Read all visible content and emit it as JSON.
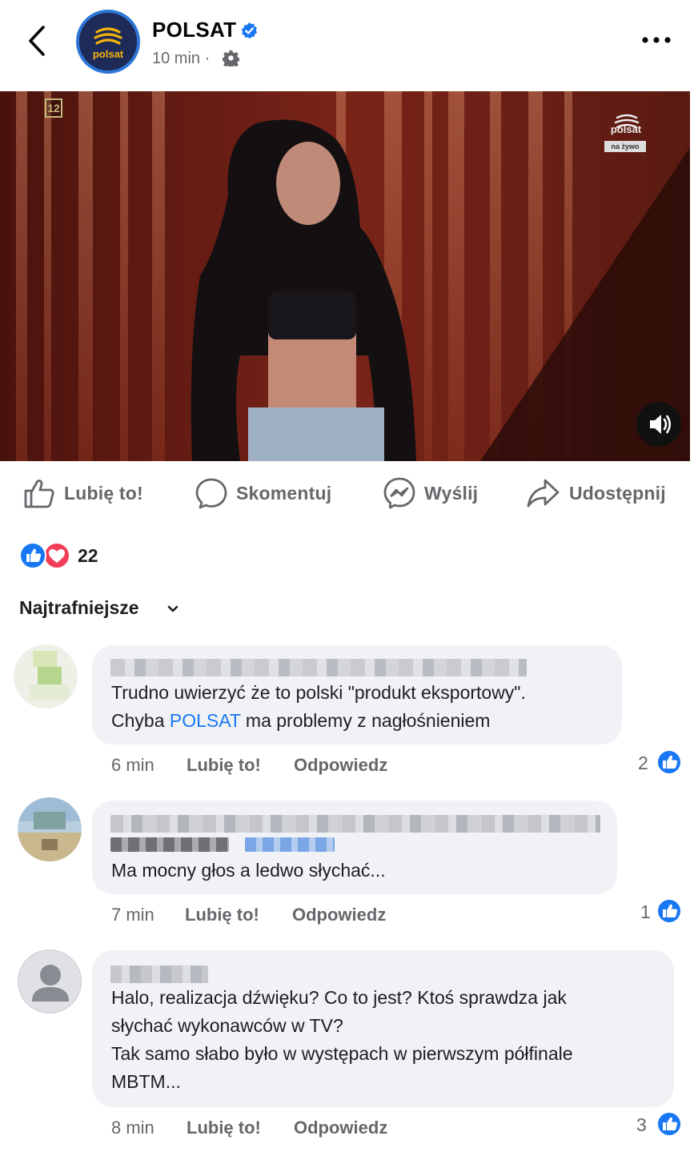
{
  "header": {
    "page_name": "POLSAT",
    "time": "10 min ·",
    "avatar_text": "polsat"
  },
  "video": {
    "age_rating": "12",
    "channel_logo": "polsat",
    "live_label": "na żywo"
  },
  "actions": {
    "like": "Lubię to!",
    "comment": "Skomentuj",
    "send": "Wyślij",
    "share": "Udostępnij"
  },
  "reactions": {
    "count": "22",
    "types": [
      "like-icon",
      "love-icon"
    ]
  },
  "sort": {
    "label": "Najtrafniejsze"
  },
  "comments": [
    {
      "text_line1": "Trudno uwierzyć że to polski \"produkt eksportowy\".",
      "text_line2_prefix": "Chyba ",
      "mention": "POLSAT",
      "text_line2_suffix": " ma problemy z nagłośnieniem",
      "time": "6 min",
      "like_label": "Lubię to!",
      "reply_label": "Odpowiedz",
      "likes": "2"
    },
    {
      "text": "Ma mocny głos a ledwo słychać...",
      "time": "7 min",
      "like_label": "Lubię to!",
      "reply_label": "Odpowiedz",
      "likes": "1"
    },
    {
      "lines": [
        "Halo, realizacja dźwięku? Co to jest? Ktoś sprawdza jak",
        "słychać wykonawców w TV?",
        "Tak samo słabo było w występach w pierwszym półfinale",
        "MBTM..."
      ],
      "time": "8 min",
      "like_label": "Lubię to!",
      "reply_label": "Odpowiedz",
      "likes": "3"
    }
  ],
  "colors": {
    "accent": "#1877f2",
    "secondary_text": "#65676b",
    "bubble": "#f0f2f5",
    "love": "#f33e58"
  }
}
